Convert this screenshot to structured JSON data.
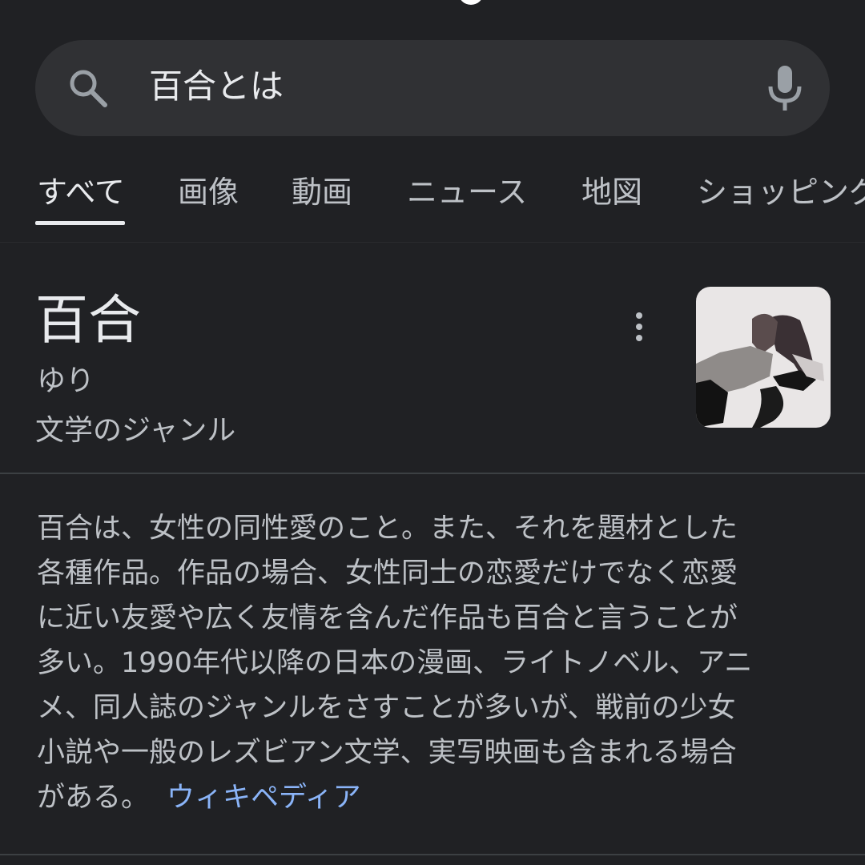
{
  "search": {
    "query": "百合とは",
    "search_icon": "search-icon",
    "mic_icon": "microphone-icon"
  },
  "tabs": [
    {
      "label": "すべて",
      "active": true
    },
    {
      "label": "画像",
      "active": false
    },
    {
      "label": "動画",
      "active": false
    },
    {
      "label": "ニュース",
      "active": false
    },
    {
      "label": "地図",
      "active": false
    },
    {
      "label": "ショッピング",
      "active": false
    }
  ],
  "knowledge_panel": {
    "title": "百合",
    "reading": "ゆり",
    "subtitle": "文学のジャンル",
    "more_icon": "more-vert-icon",
    "description_lines": [
      "百合は、女性の同性愛のこと。また、それを題材とした",
      "各種作品。作品の場合、女性同士の恋愛だけでなく恋愛",
      "に近い友愛や広く友情を含んだ作品も百合と言うことが",
      "多い。1990年代以降の日本の漫画、ライトノベル、アニ",
      "メ、同人誌のジャンルをさすことが多いが、戦前の少女",
      "小説や一般のレズビアン文学、実写映画も含まれる場合",
      "がある。"
    ],
    "source_link": "ウィキペディア"
  },
  "colors": {
    "background": "#202124",
    "search_bar": "#303134",
    "primary_text": "#e8eaed",
    "secondary_text": "#bdc1c6",
    "link": "#8ab4f8"
  }
}
